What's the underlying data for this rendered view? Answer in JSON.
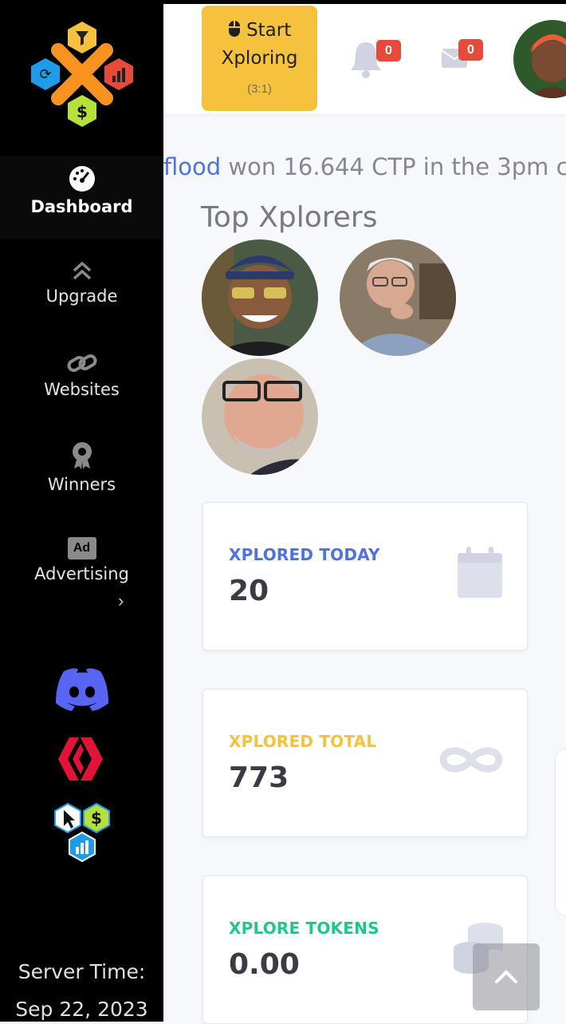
{
  "sidebar": {
    "items": [
      {
        "label": "Dashboard",
        "icon": "speedometer-icon",
        "active": true
      },
      {
        "label": "Upgrade",
        "icon": "double-chevron-up-icon"
      },
      {
        "label": "Websites",
        "icon": "link-icon"
      },
      {
        "label": "Winners",
        "icon": "award-icon"
      },
      {
        "label": "Advertising",
        "icon": "ad-icon"
      }
    ],
    "ad_badge": "Ad",
    "social": [
      "discord-icon",
      "hive-icon",
      "hex-app-icon"
    ],
    "server_time_label": "Server Time:",
    "server_date": "Sep 22, 2023"
  },
  "topbar": {
    "start_line1": "Start",
    "start_line2": "Xploring",
    "start_ratio": "(3:1)",
    "notifications_count": "0",
    "messages_count": "0"
  },
  "ticker": {
    "user": "flood",
    "text": " won 16.644 CTP in the 3pm c"
  },
  "top_xplorers": {
    "title": "Top Xplorers",
    "count": 3
  },
  "cards": [
    {
      "label": "XPLORED TODAY",
      "value": "20",
      "color": "#4e73df",
      "icon": "calendar-icon"
    },
    {
      "label": "XPLORED TOTAL",
      "value": "773",
      "color": "#f6c23e",
      "icon": "infinity-icon"
    },
    {
      "label": "XPLORE TOKENS",
      "value": "0.00",
      "color": "#1cc88a",
      "icon": "coins-icon"
    }
  ],
  "colors": {
    "sidebar_bg": "#000000",
    "accent_yellow": "#f6c23e",
    "primary_blue": "#4e73df",
    "badge_red": "#e74a3b",
    "success_green": "#1cc88a"
  }
}
